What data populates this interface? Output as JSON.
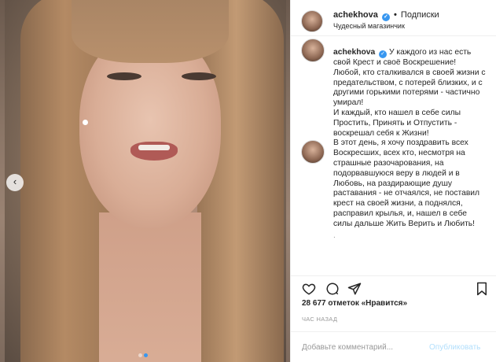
{
  "header": {
    "username": "achekhova",
    "verified_glyph": "✓",
    "separator": "•",
    "follow_label": "Подписки",
    "location": "Чудесный магазинчик"
  },
  "post": {
    "username": "achekhova",
    "verified_glyph": "✓",
    "caption_part1": "У каждого из нас есть свой Крест и своё Воскрешение!\nЛюбой, кто сталкивался в своей жизни с предательством, с потерей близких, и с другими горькими потерями - частично умирал!\nИ каждый, кто нашел в себе силы Простить, Принять и Отпустить - воскрешал себя к Жизни!",
    "caption_part2": "В этот день, я хочу поздравить всех Воскресших, всех кто, несмотря на страшные разочарования, на подорвавшуюся веру в людей и в Любовь, на раздирающие душу раставания - не отчаялся, не поставил крест на своей жизни, а поднялся, расправил крылья, и, нашел в себе силы дальше Жить Верить и Любить!",
    "ellipsis": "."
  },
  "stats": {
    "likes_text": "28 677 отметок «Нравится»",
    "time_ago": "ЧАС НАЗАД"
  },
  "comment_box": {
    "placeholder": "Добавьте комментарий...",
    "publish_label": "Опубликовать"
  },
  "carousel": {
    "prev_glyph": "‹",
    "total": 2,
    "active_index": 1
  },
  "colors": {
    "accent": "#3897f0",
    "publish_disabled": "#b2dffc"
  }
}
